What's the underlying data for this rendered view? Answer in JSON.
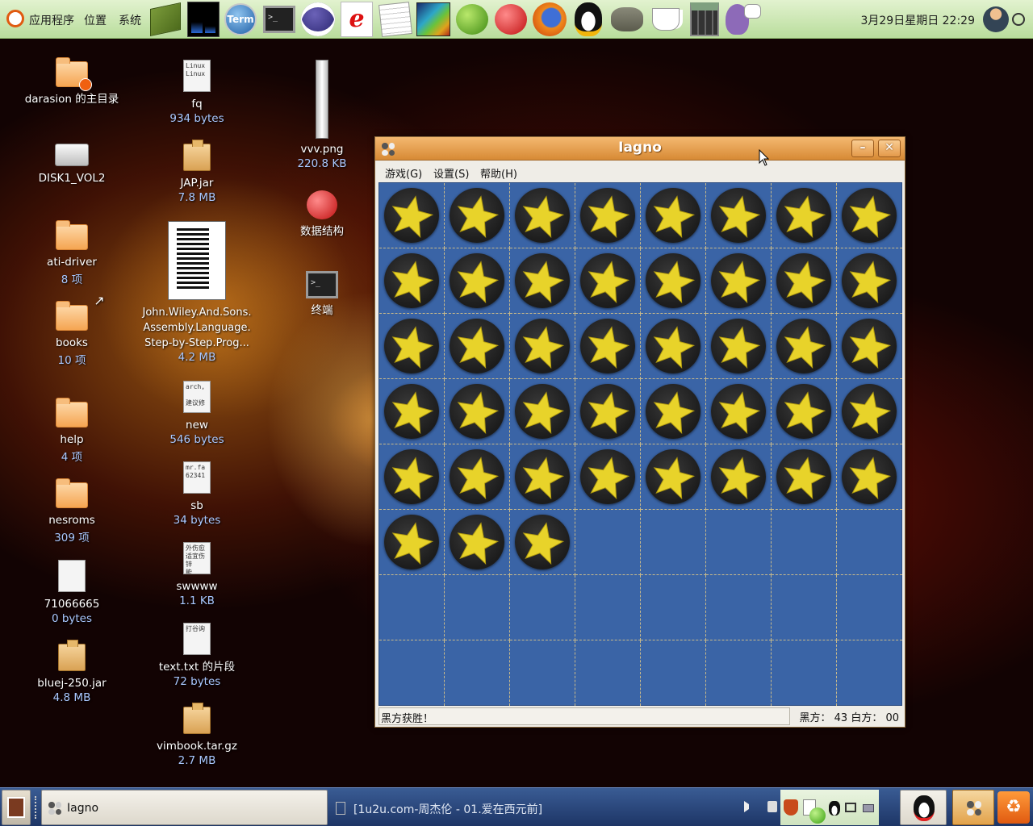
{
  "topbar": {
    "menus": [
      "应用程序",
      "位置",
      "系统"
    ],
    "clock": "3月29日星期日 22:29",
    "launchers": [
      "book-icon",
      "system-monitor-icon",
      "term-icon",
      "terminal-icon",
      "eclipse-icon",
      "browser-e-icon",
      "text-editor-icon",
      "chart-icon",
      "green-apple-icon",
      "red-apple-icon",
      "firefox-icon",
      "qq-penguin-icon",
      "gimp-icon",
      "java-cup-icon",
      "calculator-icon",
      "pidgin-icon"
    ]
  },
  "desktop": {
    "col1": [
      {
        "label": "darasion 的主目录",
        "sub": ""
      },
      {
        "label": "DISK1_VOL2",
        "sub": ""
      },
      {
        "label": "ati-driver",
        "sub": "8 项"
      },
      {
        "label": "books",
        "sub": "10 项"
      },
      {
        "label": "help",
        "sub": "4 项"
      },
      {
        "label": "nesroms",
        "sub": "309 项"
      },
      {
        "label": "71066665",
        "sub": "0 bytes"
      },
      {
        "label": "bluej-250.jar",
        "sub": "4.8 MB"
      }
    ],
    "col2": [
      {
        "label": "fq",
        "sub": "934 bytes",
        "preview": "Linux\nLinux"
      },
      {
        "label": "JAP.jar",
        "sub": "7.8 MB"
      },
      {
        "label": "John.Wiley.And.Sons.\nAssembly.Language.\nStep-by-Step.Prog...",
        "sub": "4.2 MB"
      },
      {
        "label": "new",
        "sub": "546 bytes",
        "preview": "arch,\n\n建议修"
      },
      {
        "label": "sb",
        "sub": "34 bytes",
        "preview": "mr.fa\n62341"
      },
      {
        "label": "swwww",
        "sub": "1.1 KB",
        "preview": "外伤愈\n适宜伤\n锌\n能"
      },
      {
        "label": "text.txt 的片段",
        "sub": "72 bytes",
        "preview": "打谷询"
      },
      {
        "label": "vimbook.tar.gz",
        "sub": "2.7 MB"
      }
    ],
    "col3": [
      {
        "label": "vvv.png",
        "sub": "220.8 KB"
      },
      {
        "label": "数据结构",
        "sub": ""
      },
      {
        "label": "终端",
        "sub": ""
      }
    ]
  },
  "window": {
    "title": "Iagno",
    "minimize": "–",
    "close": "✕",
    "menus": [
      "游戏(G)",
      "设置(S)",
      "帮助(H)"
    ],
    "status_left": "黑方获胜！",
    "status_right": "黑方：  43  白方：  00",
    "board_size": 8,
    "pieces_filled": 43,
    "colors": {
      "board": "#3a64a6",
      "piece": "#222222",
      "star": "#e8d32a"
    }
  },
  "taskbar": {
    "task_label": "Iagno",
    "music_label": "[1u2u.com-周杰伦 - 01.爱在西元前]"
  }
}
